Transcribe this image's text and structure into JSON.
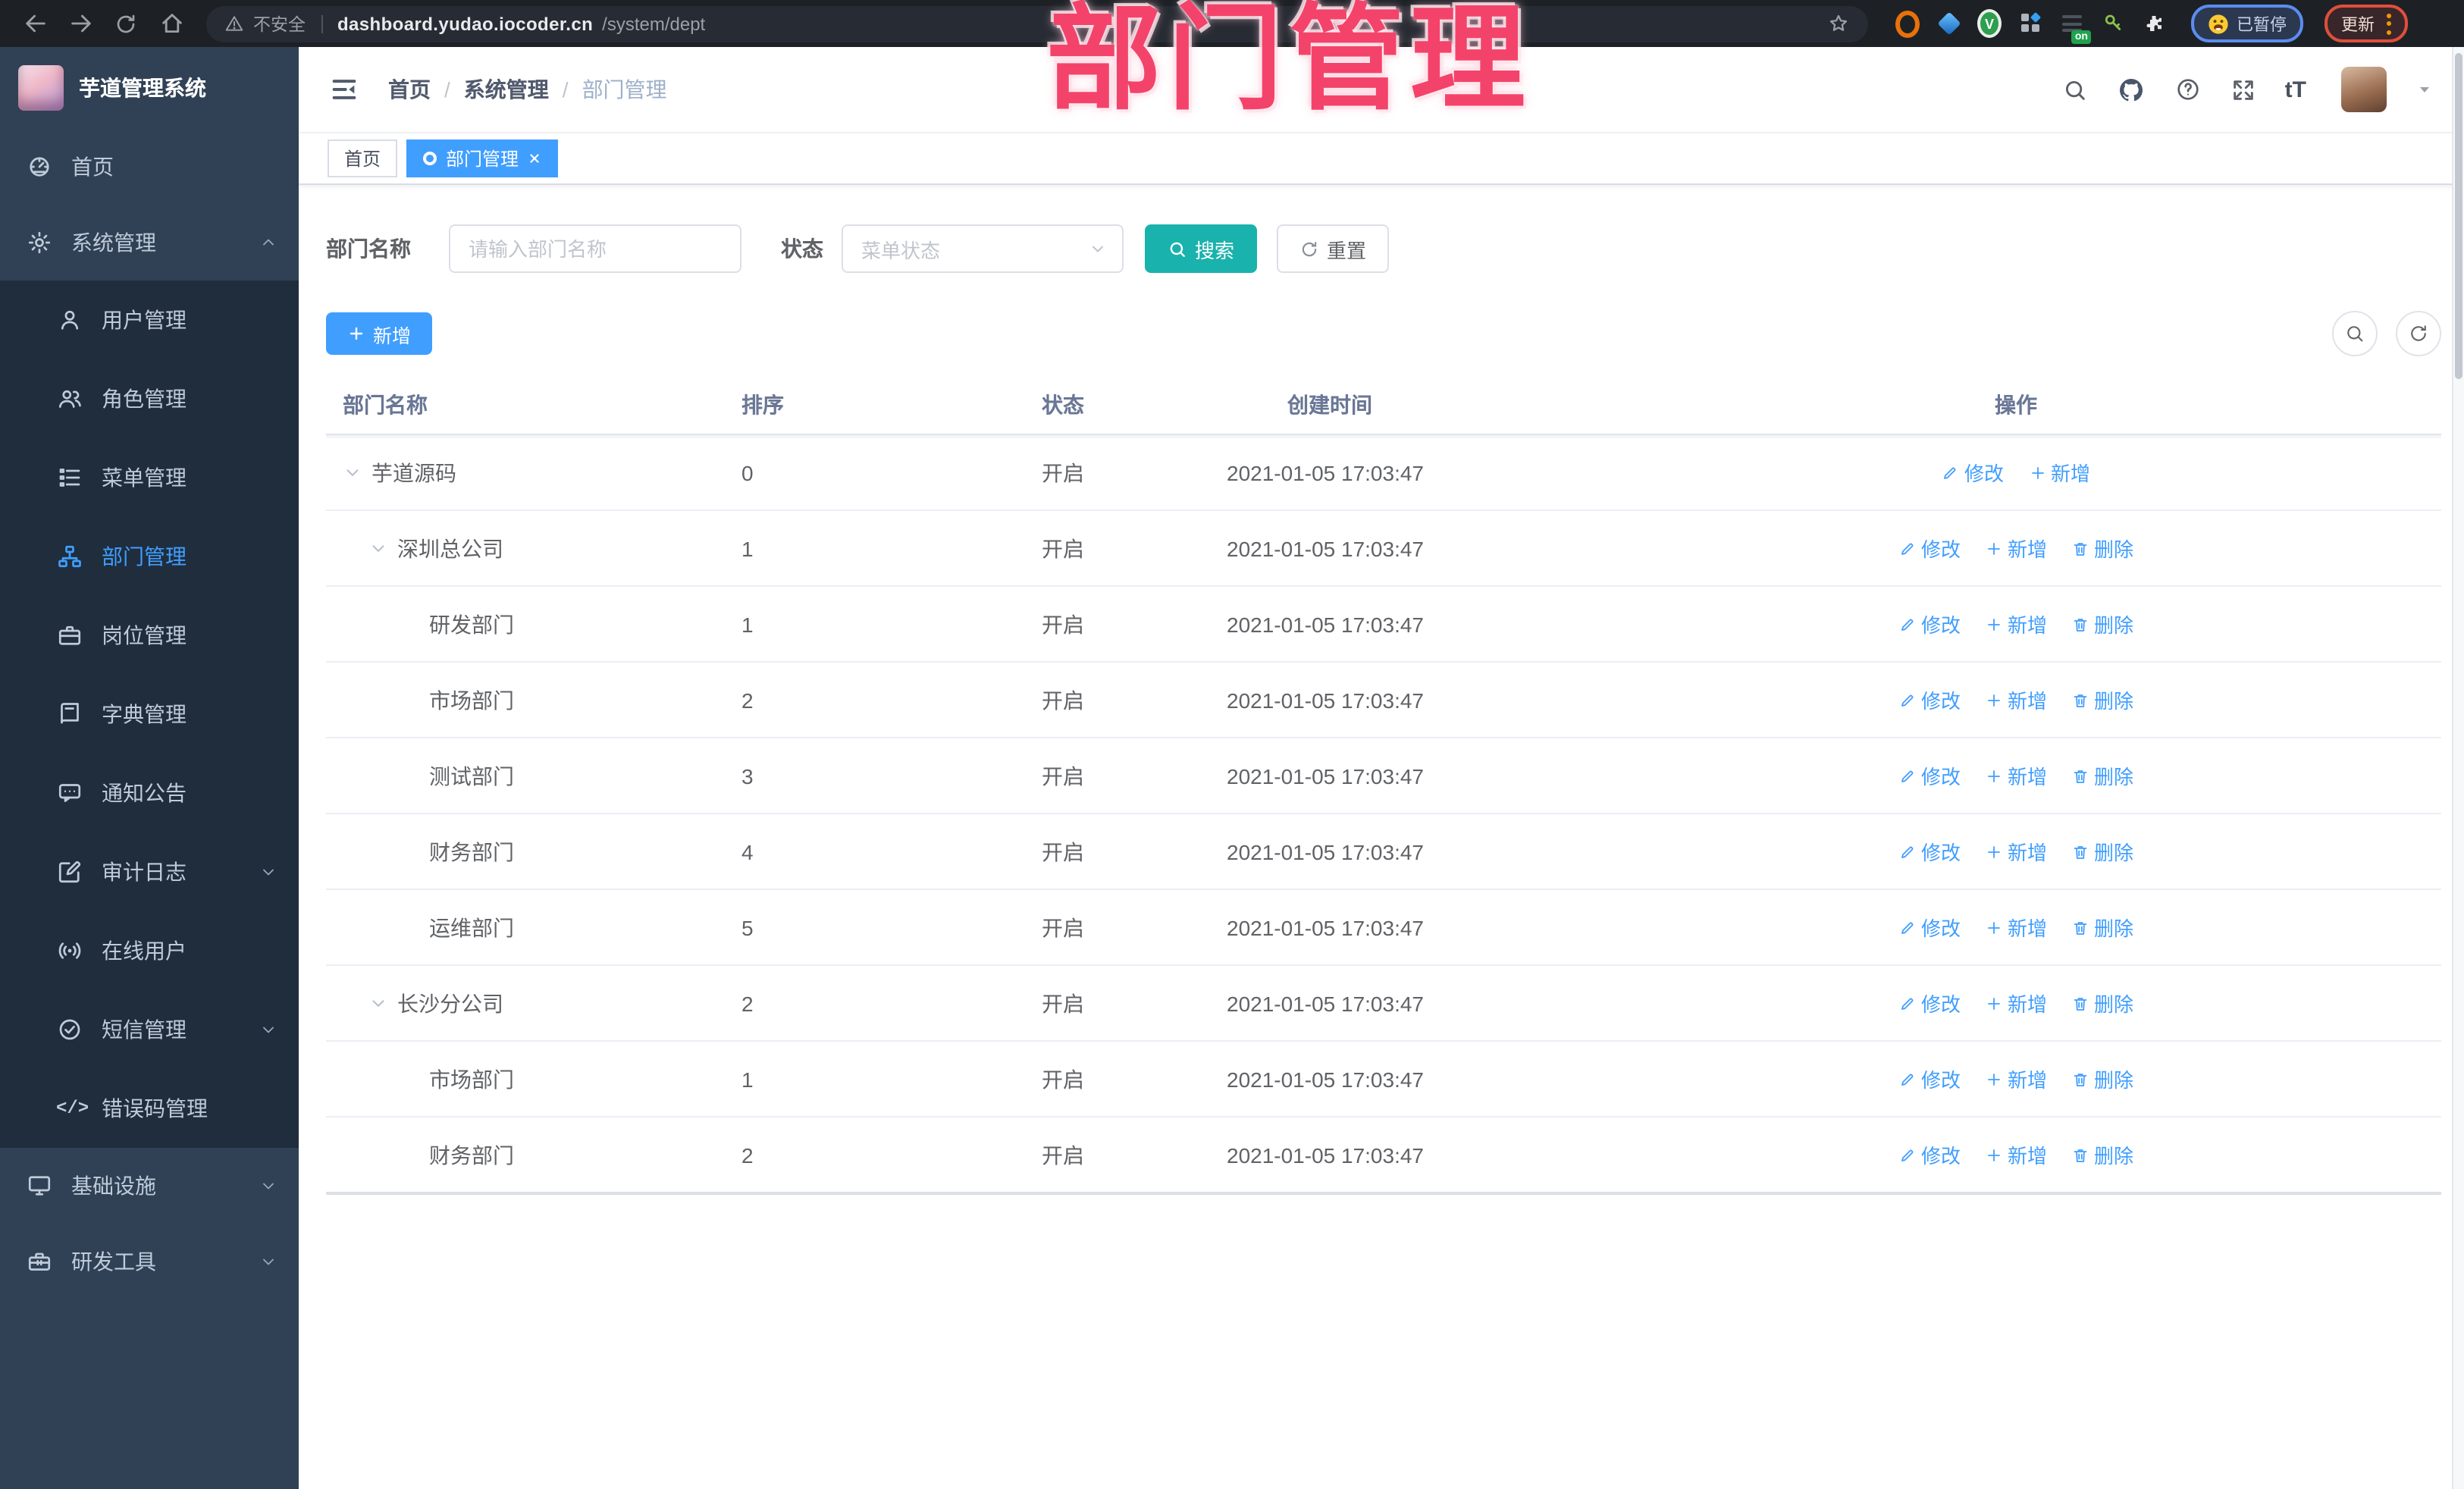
{
  "browser": {
    "security": "不安全",
    "host": "dashboard.yudao.iocoder.cn",
    "path": "/system/dept",
    "ext_badge": "on",
    "profile": "已暂停",
    "update": "更新"
  },
  "overlay": {
    "title": "部门管理"
  },
  "sidebar": {
    "title": "芋道管理系统",
    "items": [
      {
        "key": "home",
        "label": "首页",
        "icon": "dashboard",
        "level": 0
      },
      {
        "key": "system",
        "label": "系统管理",
        "icon": "gear",
        "level": 0,
        "chevron": "up"
      },
      {
        "key": "user",
        "label": "用户管理",
        "icon": "user",
        "level": 1
      },
      {
        "key": "role",
        "label": "角色管理",
        "icon": "users",
        "level": 1
      },
      {
        "key": "menu",
        "label": "菜单管理",
        "icon": "menu-list",
        "level": 1
      },
      {
        "key": "dept",
        "label": "部门管理",
        "icon": "org-tree",
        "level": 1,
        "active": true
      },
      {
        "key": "post",
        "label": "岗位管理",
        "icon": "briefcase",
        "level": 1
      },
      {
        "key": "dict",
        "label": "字典管理",
        "icon": "book",
        "level": 1
      },
      {
        "key": "notice",
        "label": "通知公告",
        "icon": "bubble",
        "level": 1
      },
      {
        "key": "audit",
        "label": "审计日志",
        "icon": "edit",
        "level": 1,
        "chevron": "down"
      },
      {
        "key": "online",
        "label": "在线用户",
        "icon": "online",
        "level": 1
      },
      {
        "key": "sms",
        "label": "短信管理",
        "icon": "check-circle",
        "level": 1,
        "chevron": "down"
      },
      {
        "key": "errcode",
        "label": "错误码管理",
        "icon": "code",
        "level": 1
      },
      {
        "key": "infra",
        "label": "基础设施",
        "icon": "monitor",
        "level": 0,
        "chevron": "down"
      },
      {
        "key": "tools",
        "label": "研发工具",
        "icon": "toolbox",
        "level": 0,
        "chevron": "down"
      }
    ]
  },
  "header": {
    "crumbs": [
      "首页",
      "系统管理",
      "部门管理"
    ]
  },
  "tabs": [
    {
      "label": "首页",
      "active": false
    },
    {
      "label": "部门管理",
      "active": true
    }
  ],
  "filters": {
    "dept_label": "部门名称",
    "dept_placeholder": "请输入部门名称",
    "status_label": "状态",
    "status_placeholder": "菜单状态",
    "search": "搜索",
    "reset": "重置"
  },
  "toolbar": {
    "add": "新增"
  },
  "table": {
    "columns": [
      "部门名称",
      "排序",
      "状态",
      "创建时间",
      "操作"
    ],
    "action_labels": {
      "edit": "修改",
      "add": "新增",
      "del": "删除"
    },
    "rows": [
      {
        "name": "芋道源码",
        "level": 0,
        "caret": true,
        "sort": "0",
        "status": "开启",
        "created": "2021-01-05 17:03:47",
        "actions": [
          "edit",
          "add"
        ]
      },
      {
        "name": "深圳总公司",
        "level": 1,
        "caret": true,
        "sort": "1",
        "status": "开启",
        "created": "2021-01-05 17:03:47",
        "actions": [
          "edit",
          "add",
          "del"
        ]
      },
      {
        "name": "研发部门",
        "level": 2,
        "caret": false,
        "sort": "1",
        "status": "开启",
        "created": "2021-01-05 17:03:47",
        "actions": [
          "edit",
          "add",
          "del"
        ]
      },
      {
        "name": "市场部门",
        "level": 2,
        "caret": false,
        "sort": "2",
        "status": "开启",
        "created": "2021-01-05 17:03:47",
        "actions": [
          "edit",
          "add",
          "del"
        ]
      },
      {
        "name": "测试部门",
        "level": 2,
        "caret": false,
        "sort": "3",
        "status": "开启",
        "created": "2021-01-05 17:03:47",
        "actions": [
          "edit",
          "add",
          "del"
        ]
      },
      {
        "name": "财务部门",
        "level": 2,
        "caret": false,
        "sort": "4",
        "status": "开启",
        "created": "2021-01-05 17:03:47",
        "actions": [
          "edit",
          "add",
          "del"
        ]
      },
      {
        "name": "运维部门",
        "level": 2,
        "caret": false,
        "sort": "5",
        "status": "开启",
        "created": "2021-01-05 17:03:47",
        "actions": [
          "edit",
          "add",
          "del"
        ]
      },
      {
        "name": "长沙分公司",
        "level": 1,
        "caret": true,
        "sort": "2",
        "status": "开启",
        "created": "2021-01-05 17:03:47",
        "actions": [
          "edit",
          "add",
          "del"
        ]
      },
      {
        "name": "市场部门",
        "level": 2,
        "caret": false,
        "sort": "1",
        "status": "开启",
        "created": "2021-01-05 17:03:47",
        "actions": [
          "edit",
          "add",
          "del"
        ]
      },
      {
        "name": "财务部门",
        "level": 2,
        "caret": false,
        "sort": "2",
        "status": "开启",
        "created": "2021-01-05 17:03:47",
        "actions": [
          "edit",
          "add",
          "del"
        ]
      }
    ]
  },
  "colors": {
    "primary": "#409eff",
    "search_teal": "#1ab2ad",
    "sidebar_bg": "#304156",
    "submenu_bg": "#1f2d3d",
    "overlay_pink": "#f4436a"
  }
}
